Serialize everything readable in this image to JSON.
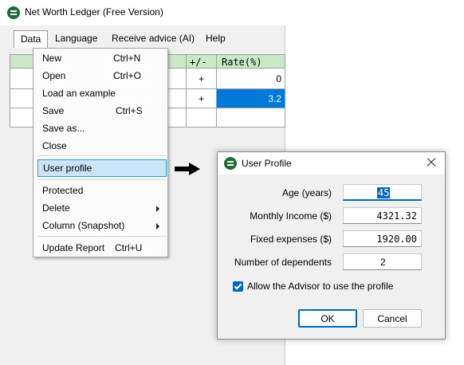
{
  "window": {
    "title": "Net Worth Ledger (Free Version)"
  },
  "menubar": {
    "items": [
      {
        "label": "Data"
      },
      {
        "label": "Language"
      },
      {
        "label": "Receive advice (AI)"
      },
      {
        "label": "Help"
      }
    ]
  },
  "grid": {
    "headers": [
      "+/-",
      "Rate(%)"
    ],
    "rows": [
      {
        "sign": "+",
        "rate": "0"
      },
      {
        "sign": "+",
        "rate": "3.2"
      },
      {
        "sign": "",
        "rate": ""
      }
    ]
  },
  "data_menu": {
    "items": [
      {
        "label": "New",
        "shortcut": "Ctrl+N"
      },
      {
        "label": "Open",
        "shortcut": "Ctrl+O"
      },
      {
        "label": "Load an example",
        "shortcut": ""
      },
      {
        "label": "Save",
        "shortcut": "Ctrl+S"
      },
      {
        "label": "Save as...",
        "shortcut": ""
      },
      {
        "label": "Close",
        "shortcut": ""
      },
      {
        "label": "User profile",
        "shortcut": ""
      },
      {
        "label": "Protected",
        "shortcut": ""
      },
      {
        "label": "Delete",
        "shortcut": ""
      },
      {
        "label": "Column (Snapshot)",
        "shortcut": ""
      },
      {
        "label": "Update Report",
        "shortcut": "Ctrl+U"
      }
    ]
  },
  "dialog": {
    "title": "User Profile",
    "fields": [
      {
        "label": "Age (years)",
        "value": "45"
      },
      {
        "label": "Monthly Income ($)",
        "value": "4321.32"
      },
      {
        "label": "Fixed expenses ($)",
        "value": "1920.00"
      },
      {
        "label": "Number of dependents",
        "value": "2"
      }
    ],
    "checkbox_label": "Allow the Advisor to use the profile",
    "ok_label": "OK",
    "cancel_label": "Cancel"
  },
  "colors": {
    "accent": "#0067c0",
    "header_green": "#c9e8c5",
    "selected_cell": "#0078d7",
    "menu_highlight": "#cce4f7"
  },
  "icons": [
    "app-icon",
    "close-icon",
    "submenu-arrow-icon",
    "pointer-arrow-icon",
    "checkmark-icon"
  ]
}
